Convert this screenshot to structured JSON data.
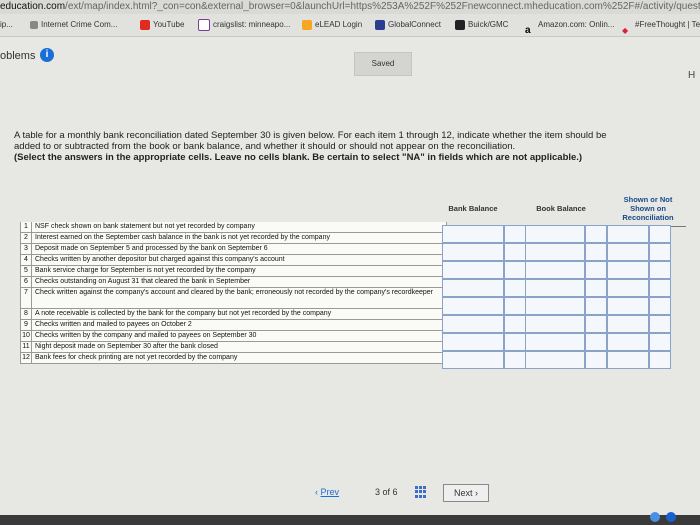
{
  "browser": {
    "url_host": "education.com",
    "url_rest": "/ext/map/index.html?_con=con&external_browser=0&launchUrl=https%253A%252F%252Fnewconnect.mheducation.com%252F#/activity/question-group",
    "bookmarks": [
      {
        "label": "ip..."
      },
      {
        "label": "Internet Crime Com..."
      },
      {
        "label": "YouTube"
      },
      {
        "label": "craigslist: minneapo..."
      },
      {
        "label": "eLEAD Login"
      },
      {
        "label": "GlobalConnect"
      },
      {
        "label": "Buick/GMC"
      },
      {
        "label": "Amazon.com: Onlin..."
      },
      {
        "label": "#FreeThought | Tee"
      }
    ]
  },
  "header": {
    "problems_label": "oblems",
    "info_glyph": "i",
    "saved_label": "Saved",
    "help_letter": "H"
  },
  "question": {
    "text": "A table for a monthly bank reconciliation dated September 30 is given below. For each item 1 through 12, indicate whether the item should be added to or subtracted from the book or bank balance, and whether it should or should not appear on the reconciliation.",
    "instruction": "(Select the answers in the appropriate cells. Leave no cells blank. Be certain to select \"NA\" in fields which are not applicable.)"
  },
  "table": {
    "headers": {
      "bank_balance": "Bank Balance",
      "book_balance": "Book Balance",
      "shown": "Shown or Not Shown on Reconciliation"
    },
    "rows": [
      {
        "num": "1",
        "text": "NSF check shown on bank statement but not yet recorded by company"
      },
      {
        "num": "2",
        "text": "Interest earned on the September cash balance in the bank is not yet recorded by the company"
      },
      {
        "num": "3",
        "text": "Deposit made on September 5 and processed by the bank on September 6"
      },
      {
        "num": "4",
        "text": "Checks written by another depositor but charged against this company's account"
      },
      {
        "num": "5",
        "text": "Bank service charge for September is not yet recorded by the company"
      },
      {
        "num": "6",
        "text": "Checks outstanding on August 31 that cleared the bank in September"
      },
      {
        "num": "7",
        "text": "Check written against the company's account and cleared by the bank; erroneously not recorded by the company's recordkeeper"
      },
      {
        "num": "8",
        "text": "A note receivable is collected by the bank for the company but not yet recorded by the company"
      },
      {
        "num": "9",
        "text": "Checks written and mailed to payees on October 2"
      },
      {
        "num": "10",
        "text": "Checks written by the company and mailed to payees on September 30"
      },
      {
        "num": "11",
        "text": "Night deposit made on September 30 after the bank closed"
      },
      {
        "num": "12",
        "text": "Bank fees for check printing are not yet recorded by the company"
      }
    ]
  },
  "pager": {
    "prev_label": "Prev",
    "page_info": "3 of 6",
    "next_label": "Next"
  }
}
